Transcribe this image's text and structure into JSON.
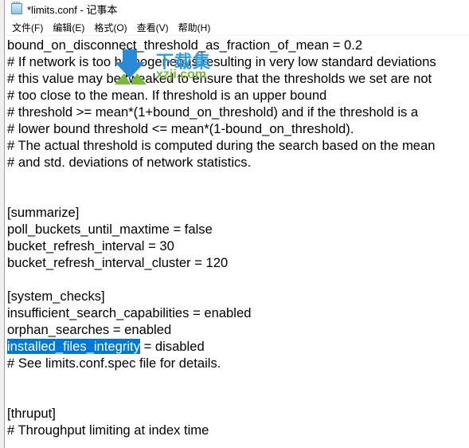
{
  "window": {
    "title": "*limits.conf - 记事本"
  },
  "menubar": {
    "items": [
      {
        "label": "文件(F)"
      },
      {
        "label": "编辑(E)"
      },
      {
        "label": "格式(O)"
      },
      {
        "label": "查看(V)"
      },
      {
        "label": "帮助(H)"
      }
    ]
  },
  "editor": {
    "lines": [
      "bound_on_disconnect_threshold_as_fraction_of_mean = 0.2",
      "# If network is too homogeneous resulting in very low standard deviations",
      "# this value may be tweaked to ensure that the thresholds we set are not",
      "# too close to the mean. If threshold is an upper bound",
      "# threshold >= mean*(1+bound_on_threshold) and if the threshold is a",
      "# lower bound threshold <= mean*(1-bound_on_threshold).",
      "# The actual threshold is computed during the search based on the mean",
      "# and std. deviations of network statistics.",
      "",
      "",
      "[summarize]",
      "poll_buckets_until_maxtime = false",
      "bucket_refresh_interval = 30",
      "bucket_refresh_interval_cluster = 120",
      "",
      "[system_checks]",
      "insufficient_search_capabilities = enabled",
      "orphan_searches = enabled",
      "",
      "# See limits.conf.spec file for details.",
      "",
      "",
      "[thruput]",
      "# Throughput limiting at index time"
    ],
    "selected_line": {
      "selected_text": "installed_files_integrity",
      "rest_text": " = disabled"
    },
    "selection_color": "#0078d7"
  },
  "watermark": {
    "brand": "下载集",
    "domain": "xzji.com"
  }
}
